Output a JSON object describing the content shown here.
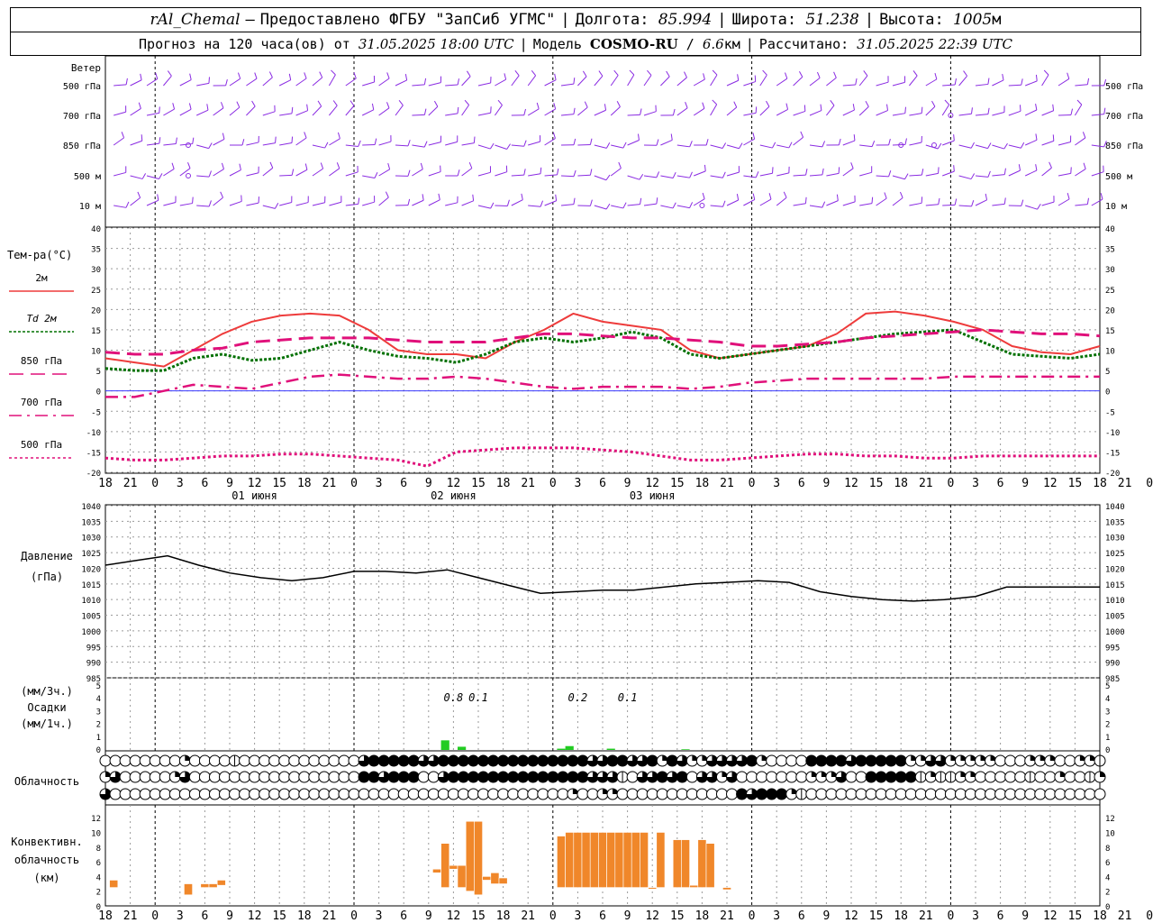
{
  "header": {
    "station_name": "rAl_Chemal",
    "provider": "Предоставлено ФГБУ \"ЗапСиб УГМС\"",
    "longitude_label": "Долгота:",
    "longitude": "85.994",
    "latitude_label": "Широта:",
    "latitude": "51.238",
    "altitude_label": "Высота:",
    "altitude": "1005",
    "altitude_unit": "м",
    "forecast_prefix": "Прогноз на 120 часа(ов) от",
    "forecast_start": "31.05.2025 18:00 UTC",
    "model_label": "Модель",
    "model_name": "COSMO-RU",
    "model_res": "6.6",
    "model_res_unit": "км",
    "computed_label": "Рассчитано:",
    "computed_at": "31.05.2025 22:39 UTC"
  },
  "colors": {
    "wind": "#8a2be2",
    "t2m": "#ee3b3b",
    "td2m": "#007000",
    "t850": "#e0107a",
    "t700": "#e0107a",
    "t500": "#e0107a",
    "zero_line": "#3a3aff",
    "pressure": "#000000",
    "precip": "#22cc22",
    "convective": "#f0872a"
  },
  "chart_data": [
    {
      "type": "wind_barbs",
      "title": "Ветер",
      "levels": [
        "500 гПа",
        "700 гПа",
        "850 гПа",
        "500 м",
        "10 м"
      ]
    },
    {
      "type": "line",
      "title": "Тем-ра(°C)",
      "ylim": [
        -20,
        40
      ],
      "yticks": [
        -20,
        -15,
        -10,
        -5,
        0,
        5,
        10,
        15,
        20,
        25,
        30,
        35,
        40
      ],
      "x_hours": [
        0,
        3,
        6,
        9,
        12,
        15,
        18,
        21,
        24,
        27,
        30,
        33,
        36,
        39,
        42,
        45,
        48,
        51,
        54,
        57,
        60,
        63,
        66,
        69,
        72,
        75,
        78,
        81,
        84,
        87,
        90,
        93,
        96,
        99,
        102,
        105,
        108,
        111,
        114,
        117,
        120
      ],
      "x_tick_labels": [
        "18",
        "21",
        "0",
        "3",
        "6",
        "9",
        "12",
        "15",
        "18",
        "21",
        "0",
        "3",
        "6",
        "9",
        "12",
        "15",
        "18",
        "21",
        "0",
        "3",
        "6",
        "9",
        "12",
        "15",
        "18",
        "21",
        "0",
        "3",
        "6",
        "9",
        "12",
        "15",
        "18",
        "21",
        "0",
        "3",
        "6",
        "9",
        "12",
        "15",
        "18",
        "21",
        "0"
      ],
      "day_labels": [
        "01 июня",
        "02 июня",
        "03 июня"
      ],
      "series": [
        {
          "name": "2м",
          "values": [
            8,
            7,
            6,
            10,
            14,
            17,
            18.5,
            19,
            18.5,
            15,
            10,
            9,
            9,
            8,
            12,
            15,
            19,
            17,
            16,
            15,
            10,
            8,
            9,
            10,
            11,
            14,
            19,
            19.5,
            18.5,
            17,
            15,
            11,
            9.5,
            9,
            11
          ]
        },
        {
          "name": "Td 2м",
          "values": [
            5.5,
            5,
            5,
            8,
            9,
            7.5,
            8,
            10,
            12,
            10,
            8.5,
            8,
            7,
            9,
            12,
            13,
            12,
            13,
            14.5,
            13,
            9,
            8,
            9,
            10,
            11,
            12,
            13,
            14,
            14.5,
            15,
            12,
            9,
            8.5,
            8,
            9
          ]
        },
        {
          "name": "850 гПа",
          "values": [
            9.5,
            9,
            9,
            10,
            10.5,
            12,
            12.5,
            13,
            13,
            13,
            12.5,
            12,
            12,
            12,
            13,
            14,
            14,
            13.5,
            13,
            13,
            12.5,
            12,
            11,
            11,
            11.5,
            12,
            13,
            13.5,
            14,
            14.5,
            15,
            14.5,
            14,
            14,
            13.5
          ]
        },
        {
          "name": "700 гПа",
          "values": [
            -1.5,
            -1.5,
            0,
            1.5,
            1,
            0.5,
            2,
            3.5,
            4,
            3.5,
            3,
            3,
            3.5,
            3,
            2,
            1,
            0.5,
            1,
            1,
            1,
            0.5,
            1,
            2,
            2.5,
            3,
            3,
            3,
            3,
            3,
            3.5,
            3.5,
            3.5,
            3.5,
            3.5,
            3.5
          ]
        },
        {
          "name": "500 гПа",
          "values": [
            -16.5,
            -17,
            -17,
            -16.5,
            -16,
            -16,
            -15.5,
            -15.5,
            -16,
            -16.5,
            -17,
            -18.5,
            -15,
            -14.5,
            -14,
            -14,
            -14,
            -14.5,
            -15,
            -16,
            -17,
            -17,
            -16.5,
            -16,
            -15.5,
            -15.5,
            -16,
            -16,
            -16.5,
            -16.5,
            -16,
            -16,
            -16,
            -16,
            -16
          ]
        }
      ]
    },
    {
      "type": "line",
      "title": "Давление",
      "ylabel": "(гПа)",
      "ylim": [
        985,
        1040
      ],
      "yticks": [
        985,
        990,
        995,
        1000,
        1005,
        1010,
        1015,
        1020,
        1025,
        1030,
        1035,
        1040
      ],
      "series": [
        {
          "name": "Давление",
          "values": [
            1021,
            1022.5,
            1024,
            1021,
            1018.5,
            1017,
            1016,
            1017,
            1019,
            1019,
            1018.5,
            1019.5,
            1017,
            1014.5,
            1012,
            1012.5,
            1013,
            1013,
            1014,
            1015,
            1015.5,
            1016,
            1015.5,
            1012.5,
            1011,
            1010,
            1009.5,
            1010,
            1011,
            1014,
            1014,
            1014,
            1014
          ]
        }
      ]
    },
    {
      "type": "bar",
      "title": "Осадки",
      "ylabel_top": "(мм/3ч.)",
      "ylabel_bottom": "(мм/1ч.)",
      "ylim": [
        0,
        5
      ],
      "yticks": [
        0,
        1,
        2,
        3,
        4,
        5
      ],
      "totals": [
        {
          "hour": 42,
          "label": "0.8"
        },
        {
          "hour": 45,
          "label": "0.1"
        },
        {
          "hour": 57,
          "label": "0.2"
        },
        {
          "hour": 63,
          "label": "0.1"
        }
      ],
      "hourly_bars": [
        {
          "hour": 41,
          "value": 0.75
        },
        {
          "hour": 43,
          "value": 0.25
        },
        {
          "hour": 55,
          "value": 0.1
        },
        {
          "hour": 56,
          "value": 0.3
        },
        {
          "hour": 61,
          "value": 0.1
        },
        {
          "hour": 70,
          "value": 0.05
        }
      ]
    },
    {
      "type": "table",
      "title": "Облачность",
      "cloud_rows": [
        "00000000200001000000000000344444334444444444444443344334243223333420000444434444422332222200022200221",
        "23000002300000000000000000443444003444444444444443331033434033230000000222300444441211220000010020012",
        "30000000000000000000000000000000000000000000000200220000000000004344421000000000000000000000000000000"
      ]
    },
    {
      "type": "bar",
      "title": "Конвективн. облачность (км)",
      "ylim": [
        0,
        13
      ],
      "yticks": [
        0,
        2,
        4,
        6,
        8,
        10,
        12
      ],
      "ranges": [
        {
          "h0": 0.5,
          "h1": 1.5,
          "bottom": 2.5,
          "top": 3.5
        },
        {
          "h0": 9.5,
          "h1": 10.5,
          "bottom": 1.5,
          "top": 3.0
        },
        {
          "h0": 11.5,
          "h1": 12.5,
          "bottom": 2.5,
          "top": 3.0
        },
        {
          "h0": 12.5,
          "h1": 13.5,
          "bottom": 2.5,
          "top": 3.0
        },
        {
          "h0": 13.5,
          "h1": 14.5,
          "bottom": 2.8,
          "top": 3.5
        },
        {
          "h0": 39.5,
          "h1": 40.5,
          "bottom": 4.5,
          "top": 5.0
        },
        {
          "h0": 40.5,
          "h1": 41.5,
          "bottom": 2.5,
          "top": 8.5
        },
        {
          "h0": 41.5,
          "h1": 42.5,
          "bottom": 5.0,
          "top": 5.5
        },
        {
          "h0": 42.5,
          "h1": 43.5,
          "bottom": 2.5,
          "top": 5.5
        },
        {
          "h0": 43.5,
          "h1": 44.5,
          "bottom": 2.0,
          "top": 11.5
        },
        {
          "h0": 44.5,
          "h1": 45.5,
          "bottom": 1.5,
          "top": 11.5
        },
        {
          "h0": 45.5,
          "h1": 46.5,
          "bottom": 3.5,
          "top": 4.0
        },
        {
          "h0": 46.5,
          "h1": 47.5,
          "bottom": 3.0,
          "top": 4.5
        },
        {
          "h0": 47.5,
          "h1": 48.5,
          "bottom": 3.0,
          "top": 3.8
        },
        {
          "h0": 54.5,
          "h1": 55.5,
          "bottom": 2.5,
          "top": 9.5
        },
        {
          "h0": 55.5,
          "h1": 56.5,
          "bottom": 2.5,
          "top": 10.0
        },
        {
          "h0": 56.5,
          "h1": 57.5,
          "bottom": 2.5,
          "top": 10.0
        },
        {
          "h0": 57.5,
          "h1": 58.5,
          "bottom": 2.5,
          "top": 10.0
        },
        {
          "h0": 58.5,
          "h1": 59.5,
          "bottom": 2.5,
          "top": 10.0
        },
        {
          "h0": 59.5,
          "h1": 60.5,
          "bottom": 2.5,
          "top": 10.0
        },
        {
          "h0": 60.5,
          "h1": 61.5,
          "bottom": 2.5,
          "top": 10.0
        },
        {
          "h0": 61.5,
          "h1": 62.5,
          "bottom": 2.5,
          "top": 10.0
        },
        {
          "h0": 62.5,
          "h1": 63.5,
          "bottom": 2.5,
          "top": 10.0
        },
        {
          "h0": 63.5,
          "h1": 64.5,
          "bottom": 2.5,
          "top": 10.0
        },
        {
          "h0": 64.5,
          "h1": 65.5,
          "bottom": 2.5,
          "top": 10.0
        },
        {
          "h0": 65.5,
          "h1": 66.5,
          "bottom": 2.3,
          "top": 2.5
        },
        {
          "h0": 66.5,
          "h1": 67.5,
          "bottom": 2.5,
          "top": 10.0
        },
        {
          "h0": 68.5,
          "h1": 69.5,
          "bottom": 2.5,
          "top": 9.0
        },
        {
          "h0": 69.5,
          "h1": 70.5,
          "bottom": 2.5,
          "top": 9.0
        },
        {
          "h0": 70.5,
          "h1": 71.5,
          "bottom": 2.5,
          "top": 2.8
        },
        {
          "h0": 71.5,
          "h1": 72.5,
          "bottom": 2.5,
          "top": 9.0
        },
        {
          "h0": 72.5,
          "h1": 73.5,
          "bottom": 2.5,
          "top": 8.5
        },
        {
          "h0": 74.5,
          "h1": 75.5,
          "bottom": 2.2,
          "top": 2.5
        }
      ]
    }
  ]
}
